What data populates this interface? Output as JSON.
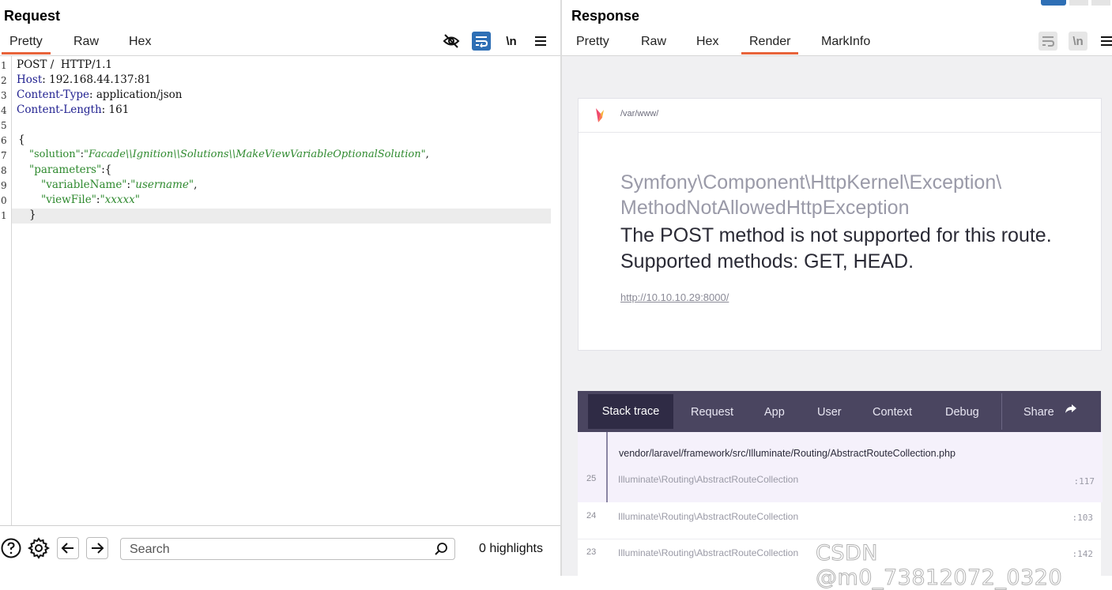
{
  "request": {
    "title": "Request",
    "tabs": [
      "Pretty",
      "Raw",
      "Hex"
    ],
    "active_tab": "Pretty",
    "tools": {
      "newline": "\\n"
    },
    "line_numbers": [
      "1",
      "2",
      "3",
      "4",
      "5",
      "6",
      "7",
      "8",
      "9",
      "0",
      "1"
    ],
    "lines": {
      "l1": "POST /  HTTP/1.1",
      "l2_key": "Host",
      "l2_val": ": 192.168.44.137:81",
      "l3_key": "Content-Type",
      "l3_val": ": application/json",
      "l4_key": "Content-Length",
      "l4_val": ": 161",
      "l6": "{",
      "l7_key": "\"solution\"",
      "l7_colon": ":",
      "l7_val": "\"Facade\\\\Ignition\\\\Solutions\\\\MakeViewVariableOptionalSolution\"",
      "l7_end": ",",
      "l8_key": "\"parameters\"",
      "l8_rest": ":{",
      "l9_key": "\"variableName\"",
      "l9_colon": ":",
      "l9_val": "\"username\"",
      "l9_end": ",",
      "l10_key": "\"viewFile\"",
      "l10_colon": ":",
      "l10_val": "\"xxxxx\"",
      "l11": "}"
    },
    "search": {
      "placeholder": "Search",
      "value": ""
    },
    "highlights": "0 highlights"
  },
  "response": {
    "title": "Response",
    "tabs": [
      "Pretty",
      "Raw",
      "Hex",
      "Render",
      "MarkInfo"
    ],
    "active_tab": "Render",
    "tools": {
      "newline": "\\n"
    },
    "error": {
      "path": "/var/www/",
      "exception_class_1": "Symfony\\Component\\HttpKernel\\Exception\\",
      "exception_class_2": "MethodNotAllowedHttpException",
      "message": "The POST method is not supported for this route. Supported methods: GET, HEAD.",
      "url": "http://10.10.10.29:8000/"
    },
    "stack_nav": [
      "Stack trace",
      "Request",
      "App",
      "User",
      "Context",
      "Debug",
      "Share"
    ],
    "frames": [
      {
        "file": "vendor/laravel/framework/src/Illuminate/Routing/AbstractRouteCollection.php",
        "num": "25",
        "class": "Illuminate\\Routing\\AbstractRouteCollection",
        "line": ":117"
      },
      {
        "num": "24",
        "class": "Illuminate\\Routing\\AbstractRouteCollection",
        "line": ":103"
      },
      {
        "num": "23",
        "class": "Illuminate\\Routing\\AbstractRouteCollection",
        "line": ":142"
      }
    ]
  },
  "watermark": "CSDN @m0_73812072_0320",
  "colors": {
    "accent": "#e8633a",
    "stack_nav_bg": "#4a4560",
    "code_string": "#2f8a2f",
    "code_key": "#1f1f8f"
  }
}
